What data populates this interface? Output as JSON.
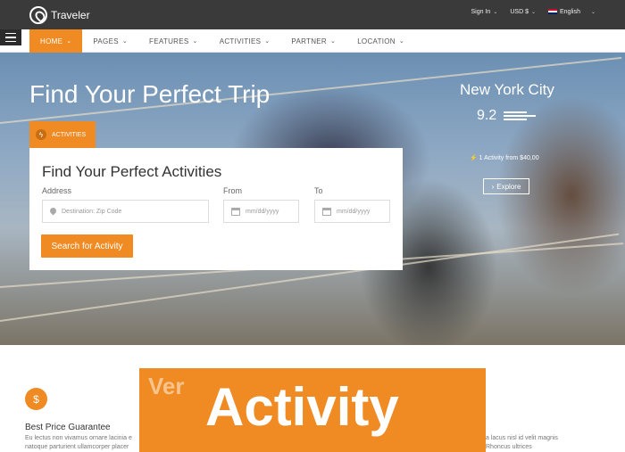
{
  "header": {
    "logo_text": "Traveler",
    "sign_in": "Sign In",
    "currency": "USD $",
    "language": "English"
  },
  "nav": {
    "items": [
      {
        "label": "HOME",
        "active": true
      },
      {
        "label": "PAGES"
      },
      {
        "label": "FEATURES"
      },
      {
        "label": "ACTIVITIES"
      },
      {
        "label": "PARTNER"
      },
      {
        "label": "LOCATION"
      }
    ]
  },
  "hero": {
    "title": "Find Your Perfect Trip",
    "city": "New York City",
    "rating": "9.2",
    "activity_info": "1 Activity from $40,00",
    "explore_label": "Explore"
  },
  "search": {
    "tab_label": "ACTIVITIES",
    "panel_title": "Find Your Perfect Activities",
    "address_label": "Address",
    "address_placeholder": "Destination: Zip Code",
    "from_label": "From",
    "from_placeholder": "mm/dd/yyyy",
    "to_label": "To",
    "to_placeholder": "mm/dd/yyyy",
    "button_label": "Search for Activity"
  },
  "features": {
    "icon_glyph": "$",
    "title": "Best Price Guarantee",
    "text_line1": "Eu lectus non vivamus ornare lacinia e",
    "text_line2": "natoque parturient ullamcorper placer",
    "right_line1": "a lacus nisl id velit magnis",
    "right_line2": "Rhoncus ultrices"
  },
  "overlay": {
    "small": "Ver",
    "big": "Activity"
  },
  "colors": {
    "accent": "#f08a22",
    "topbar": "#3a3a3a"
  }
}
